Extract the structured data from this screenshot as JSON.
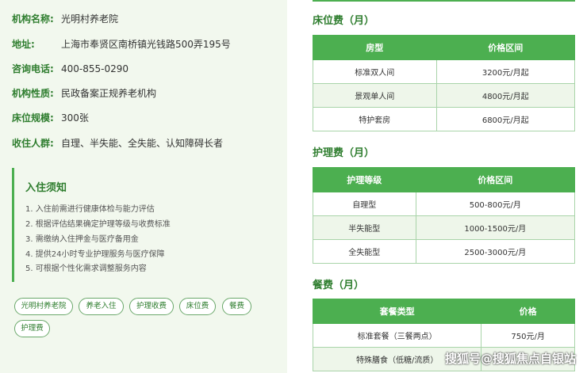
{
  "info": [
    {
      "label": "机构名称:",
      "value": "光明村养老院"
    },
    {
      "label": "地址:",
      "value": "上海市奉贤区南桥镇光钱路500弄195号"
    },
    {
      "label": "咨询电话:",
      "value": "400-855-0290"
    },
    {
      "label": "机构性质:",
      "value": "民政备案正规养老机构"
    },
    {
      "label": "床位规模:",
      "value": "300张"
    },
    {
      "label": "收住人群:",
      "value": "自理、半失能、全失能、认知障碍长者"
    }
  ],
  "notice": {
    "title": "入住须知",
    "items": [
      "1. 入住前需进行健康体检与能力评估",
      "2. 根据评估结果确定护理等级与收费标准",
      "3. 需缴纳入住押金与医疗备用金",
      "4. 提供24小时专业护理服务与医疗保障",
      "5. 可根据个性化需求调整服务内容"
    ]
  },
  "tags": [
    "光明村养老院",
    "养老入住",
    "护理收费",
    "床位费",
    "餐费",
    "护理费"
  ],
  "bed": {
    "title": "床位费（月）",
    "headers": [
      "房型",
      "价格区间"
    ],
    "rows": [
      [
        "标准双人间",
        "3200元/月起"
      ],
      [
        "景观单人间",
        "4800元/月起"
      ],
      [
        "特护套房",
        "6800元/月起"
      ]
    ]
  },
  "care": {
    "title": "护理费（月）",
    "headers": [
      "护理等级",
      "价格区间"
    ],
    "rows": [
      [
        "自理型",
        "500-800元/月"
      ],
      [
        "半失能型",
        "1000-1500元/月"
      ],
      [
        "全失能型",
        "2500-3000元/月"
      ]
    ]
  },
  "meal": {
    "title": "餐费（月）",
    "headers": [
      "套餐类型",
      "价格"
    ],
    "rows": [
      [
        "标准套餐（三餐两点）",
        "750元/月"
      ],
      [
        "特殊膳食（低糖/流质）",
        ""
      ]
    ]
  },
  "watermark": "搜狐号@搜狐焦点自银站"
}
